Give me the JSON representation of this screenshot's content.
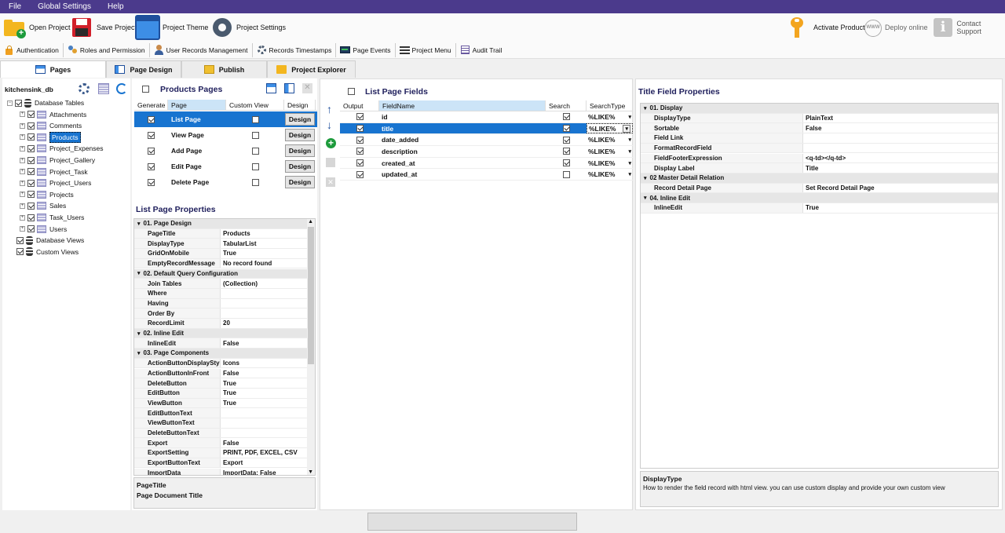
{
  "menu": [
    "File",
    "Global Settings",
    "Help"
  ],
  "ribbon": {
    "open": "Open Project",
    "save": "Save Project",
    "theme": "Project Theme",
    "settings": "Project Settings",
    "activate": "Activate Product",
    "deploy": "Deploy online",
    "support": "Contact Support"
  },
  "toolbar2": [
    "Authentication",
    "Roles and Permission",
    "User Records Management",
    "Records Timestamps",
    "Page Events",
    "Project Menu",
    "Audit Trail"
  ],
  "tabs": [
    "Pages",
    "Page Design",
    "Publish",
    "Project Explorer"
  ],
  "tree": {
    "db": "kitchensink_db",
    "root": "Database Tables",
    "tables": [
      "Attachments",
      "Comments",
      "Products",
      "Project_Expenses",
      "Project_Gallery",
      "Project_Task",
      "Project_Users",
      "Projects",
      "Sales",
      "Task_Users",
      "Users"
    ],
    "views": "Database Views",
    "custom": "Custom Views"
  },
  "pages": {
    "title": "Products Pages",
    "headers": [
      "Generate",
      "Page",
      "Custom View",
      "Design"
    ],
    "design_label": "Design",
    "rows": [
      {
        "name": "List Page",
        "gen": true,
        "custom": false
      },
      {
        "name": "View Page",
        "gen": true,
        "custom": false
      },
      {
        "name": "Add Page",
        "gen": true,
        "custom": false
      },
      {
        "name": "Edit Page",
        "gen": true,
        "custom": false
      },
      {
        "name": "Delete Page",
        "gen": true,
        "custom": false
      }
    ]
  },
  "listprops": {
    "title": "List Page Properties",
    "items": [
      {
        "cat": "01. Page Design"
      },
      {
        "n": "PageTitle",
        "v": "Products"
      },
      {
        "n": "DisplayType",
        "v": "TabularList"
      },
      {
        "n": "GridOnMobile",
        "v": "True"
      },
      {
        "n": "EmptyRecordMessage",
        "v": "No record found"
      },
      {
        "cat": "02. Default Query Configuration"
      },
      {
        "n": "Join Tables",
        "v": "(Collection)"
      },
      {
        "n": "Where",
        "v": ""
      },
      {
        "n": "Having",
        "v": ""
      },
      {
        "n": "Order By",
        "v": ""
      },
      {
        "n": "RecordLimit",
        "v": "20"
      },
      {
        "cat": "02. Inline Edit"
      },
      {
        "n": "InlineEdit",
        "v": "False"
      },
      {
        "cat": "03. Page Components"
      },
      {
        "n": "ActionButtonDisplayStyle",
        "v": "Icons"
      },
      {
        "n": "ActionButtonInFront",
        "v": "False"
      },
      {
        "n": "DeleteButton",
        "v": "True"
      },
      {
        "n": "EditButton",
        "v": "True"
      },
      {
        "n": "ViewButton",
        "v": "True"
      },
      {
        "n": "EditButtonText",
        "v": ""
      },
      {
        "n": "ViewButtonText",
        "v": ""
      },
      {
        "n": "DeleteButtonText",
        "v": ""
      },
      {
        "n": "Export",
        "v": "False"
      },
      {
        "n": "ExportSetting",
        "v": "PRINT, PDF, EXCEL, CSV"
      },
      {
        "n": "ExportButtonText",
        "v": "Export"
      },
      {
        "n": "ImportData",
        "v": "ImportData: False"
      }
    ],
    "desc_title": "PageTitle",
    "desc_text": "Page Document Title"
  },
  "fields": {
    "title": "List Page Fields",
    "headers": [
      "Output",
      "FieldName",
      "Search",
      "SearchType"
    ],
    "rows": [
      {
        "name": "id",
        "out": true,
        "search": true,
        "type": "%LIKE%"
      },
      {
        "name": "title",
        "out": true,
        "search": true,
        "type": "%LIKE%"
      },
      {
        "name": "date_added",
        "out": true,
        "search": true,
        "type": "%LIKE%"
      },
      {
        "name": "description",
        "out": true,
        "search": true,
        "type": "%LIKE%"
      },
      {
        "name": "created_at",
        "out": true,
        "search": true,
        "type": "%LIKE%"
      },
      {
        "name": "updated_at",
        "out": true,
        "search": false,
        "type": "%LIKE%"
      }
    ]
  },
  "titleprops": {
    "title": "Title Field Properties",
    "items": [
      {
        "cat": "01. Display"
      },
      {
        "n": "DisplayType",
        "v": "PlainText"
      },
      {
        "n": "Sortable",
        "v": "False"
      },
      {
        "n": "Field Link",
        "v": ""
      },
      {
        "n": "FormatRecordField",
        "v": ""
      },
      {
        "n": "FieldFooterExpression",
        "v": "<q-td></q-td>"
      },
      {
        "n": "Display Label",
        "v": "Title"
      },
      {
        "cat": "02 Master Detail Relation"
      },
      {
        "n": "Record Detail Page",
        "v": "Set Record Detail Page"
      },
      {
        "cat": "04. Inline Edit"
      },
      {
        "n": "InlineEdit",
        "v": "True"
      }
    ],
    "desc_title": "DisplayType",
    "desc_text": "How to render the field record with html view. you can use custom display and provide your own custom view"
  },
  "colors": {
    "menubar": "#4b3a8c",
    "selection": "#1874d0",
    "header": "#1f1f5c"
  }
}
